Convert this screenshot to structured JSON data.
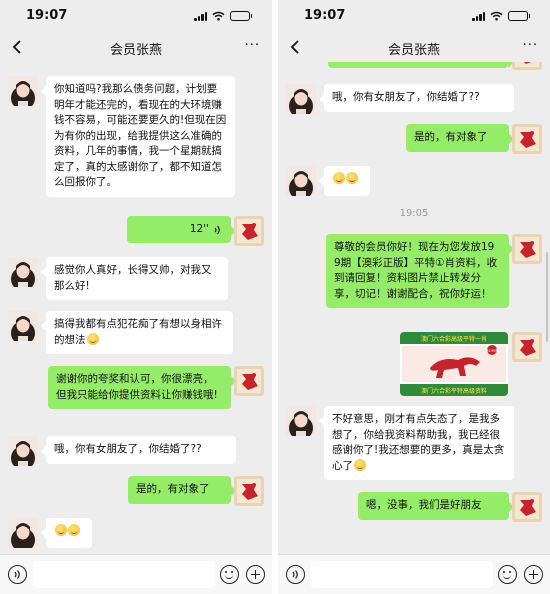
{
  "left": {
    "status": {
      "time": "19:07"
    },
    "nav": {
      "title": "会员张燕",
      "more": "···"
    },
    "voice_duration": "12''",
    "messages": {
      "m1": "你知道吗?我那么债务问题，计划要明年才能还完的，看现在的大环境赚钱不容易，可能还要更久的!但现在因为有你的出现，给我提供这么准确的资料，几年的事情，我一个星期就搞定了，真的太感谢你了，都不知道怎么回报你了。",
      "m3": "感觉你人真好，长得又帅，对我又那么好!",
      "m4": "搞得我都有点犯花痴了有想以身相许的想法",
      "m5": "谢谢你的夸奖和认可，你很漂亮，但我只能给你提供资料让你赚钱哦!",
      "m6": "哦，你有女朋友了，你结婚了??",
      "m7": "是的，有对象了"
    }
  },
  "right": {
    "status": {
      "time": "19:07"
    },
    "nav": {
      "title": "会员张燕",
      "more": "···"
    },
    "timestamp": "19:05",
    "messages": {
      "r1": "哦，你有女朋友了，你结婚了??",
      "r2": "是的，有对象了",
      "r4": "尊敬的会员你好！现在为您发放199期【澳彩正版】平特①肖资料，收到请回复！资料图片禁止转发分享，切记！谢谢配合，祝你好运！",
      "r6": "不好意思，刚才有点失态了，是我多想了，你给我资料帮助我，我已经很感谢你了!我还想要的更多，真是太贪心了",
      "r7": "嗯，没事，我们是好朋友"
    },
    "image_banner": {
      "top": "澳门六合彩高级平特一肖",
      "badge": "第199期",
      "bottom": "澳门六合彩平特高级资料"
    }
  },
  "colors": {
    "chat_bg": "#ededed",
    "bubble_in": "#ffffff",
    "bubble_out": "#95ec69",
    "avatar_right": "#c5242b"
  },
  "icons": [
    "back-icon",
    "more-icon",
    "signal-icon",
    "wifi-icon",
    "battery-icon",
    "voice-input-icon",
    "emoji-icon",
    "plus-icon",
    "voice-wave-icon",
    "smile-emoji-icon"
  ]
}
